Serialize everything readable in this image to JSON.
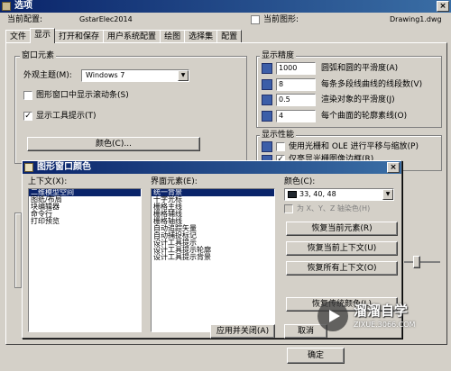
{
  "window": {
    "title": "选项",
    "close": "×"
  },
  "config": {
    "current_label": "当前配置:",
    "current_value": "GstarElec2014",
    "drawing_label": "当前图形:",
    "drawing_value": "Drawing1.dwg"
  },
  "tabs": [
    "文件",
    "显示",
    "打开和保存",
    "用户系统配置",
    "绘图",
    "选择集",
    "配置"
  ],
  "window_elements": {
    "group": "窗口元素",
    "theme_label": "外观主题(M):",
    "theme_value": "Windows 7",
    "scrollbar_check": "图形窗口中显示滚动条(S)",
    "tooltip_check": "显示工具提示(T)",
    "tooltip_mark": "✓",
    "color_button": "颜色(C)..."
  },
  "display_precision": {
    "group": "显示精度",
    "items": [
      {
        "value": "1000",
        "label": "圆弧和圆的平滑度(A)"
      },
      {
        "value": "8",
        "label": "每条多段线曲线的线段数(V)"
      },
      {
        "value": "0.5",
        "label": "渲染对象的平滑度(J)"
      },
      {
        "value": "4",
        "label": "每个曲面的轮廓素线(O)"
      }
    ]
  },
  "display_performance": {
    "group": "显示性能",
    "items": [
      {
        "label": "使用光栅和 OLE 进行平移与缩放(P)",
        "mark": ""
      },
      {
        "label": "仅亮显光栅图像边框(R)",
        "mark": "✓"
      }
    ]
  },
  "dialog": {
    "title": "图形窗口颜色",
    "close": "×",
    "context_label": "上下文(X):",
    "contexts": [
      "二维模型空间",
      "图纸/布局",
      "块编辑器",
      "命令行",
      "打印预览"
    ],
    "element_label": "界面元素(E):",
    "elements": [
      "统一背景",
      "十字光标",
      "栅格主线",
      "栅格辅线",
      "栅格轴线",
      "自动追踪矢量",
      "自动捕捉标记",
      "设计工具提示",
      "设计工具提示轮廓",
      "设计工具提示背景"
    ],
    "color_label": "颜色(C):",
    "color_value": "33, 40, 48",
    "tint_check": "为 X、Y、Z 轴染色(H)",
    "btn_restore_element": "恢复当前元素(R)",
    "btn_restore_context": "恢复当前上下文(U)",
    "btn_restore_all": "恢复所有上下文(O)",
    "btn_restore_classic": "恢复传统颜色(L)",
    "btn_apply": "应用并关闭(A)",
    "btn_cancel": "取消"
  },
  "footer": {
    "ok": "确定"
  },
  "watermark": {
    "title": "溜溜自学",
    "url": "ZIXUE.3066.COM"
  },
  "colors": {
    "title_bar": "#0a246a",
    "selection": "#0a246a",
    "swatch": "#212830"
  }
}
